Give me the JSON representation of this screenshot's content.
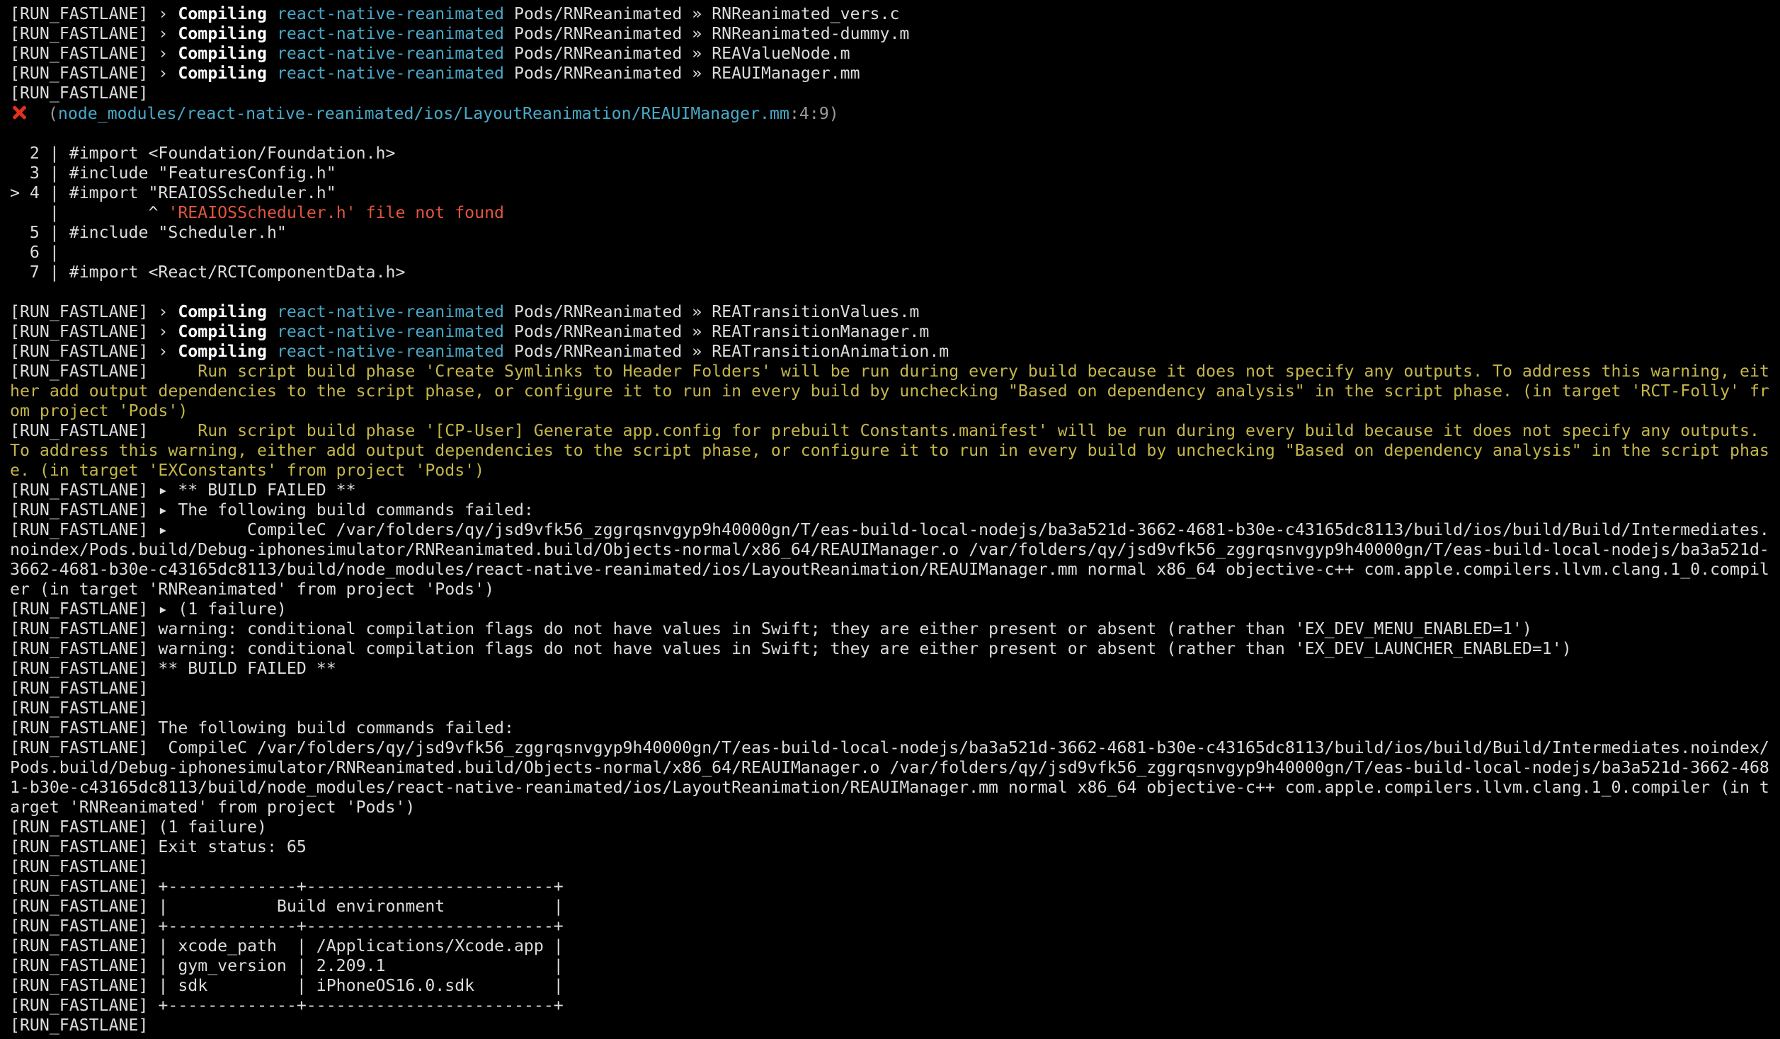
{
  "colors": {
    "background": "#000000",
    "text": "#dcdcdc",
    "bold": "#ffffff",
    "module": "#48a9c8",
    "error": "#e0553f",
    "warning": "#c4b64a",
    "error_icon": "#e0311f"
  },
  "icons": {
    "error": "cross-mark-icon"
  },
  "lines": [
    {
      "segs": [
        {
          "t": "[RUN_FASTLANE] › "
        },
        {
          "t": "Compiling",
          "c": "bold"
        },
        {
          "t": " "
        },
        {
          "t": "react-native-reanimated",
          "c": "cyan"
        },
        {
          "t": " Pods/RNReanimated » RNReanimated_vers.c"
        }
      ]
    },
    {
      "segs": [
        {
          "t": "[RUN_FASTLANE] › "
        },
        {
          "t": "Compiling",
          "c": "bold"
        },
        {
          "t": " "
        },
        {
          "t": "react-native-reanimated",
          "c": "cyan"
        },
        {
          "t": " Pods/RNReanimated » RNReanimated-dummy.m"
        }
      ]
    },
    {
      "segs": [
        {
          "t": "[RUN_FASTLANE] › "
        },
        {
          "t": "Compiling",
          "c": "bold"
        },
        {
          "t": " "
        },
        {
          "t": "react-native-reanimated",
          "c": "cyan"
        },
        {
          "t": " Pods/RNReanimated » REAValueNode.m"
        }
      ]
    },
    {
      "segs": [
        {
          "t": "[RUN_FASTLANE] › "
        },
        {
          "t": "Compiling",
          "c": "bold"
        },
        {
          "t": " "
        },
        {
          "t": "react-native-reanimated",
          "c": "cyan"
        },
        {
          "t": " Pods/RNReanimated » REAUIManager.mm"
        }
      ]
    },
    {
      "segs": [
        {
          "t": "[RUN_FASTLANE]"
        }
      ]
    },
    {
      "icon": true,
      "segs": [
        {
          "t": "  (",
          "c": "dim"
        },
        {
          "t": "node_modules/react-native-reanimated/ios/LayoutReanimation/REAUIManager.mm",
          "c": "cyan"
        },
        {
          "t": ":4:9)",
          "c": "dim"
        }
      ]
    },
    {
      "segs": [
        {
          "t": ""
        }
      ]
    },
    {
      "segs": [
        {
          "t": "  2 | #import <Foundation/Foundation.h>"
        }
      ]
    },
    {
      "segs": [
        {
          "t": "  3 | #include \"FeaturesConfig.h\""
        }
      ]
    },
    {
      "segs": [
        {
          "t": "> 4 | #import \"REAIOSScheduler.h\""
        }
      ]
    },
    {
      "segs": [
        {
          "t": "    |         ^ "
        },
        {
          "t": "'REAIOSScheduler.h' file not found",
          "c": "red"
        }
      ]
    },
    {
      "segs": [
        {
          "t": "  5 | #include \"Scheduler.h\""
        }
      ]
    },
    {
      "segs": [
        {
          "t": "  6 |"
        }
      ]
    },
    {
      "segs": [
        {
          "t": "  7 | #import <React/RCTComponentData.h>"
        }
      ]
    },
    {
      "segs": [
        {
          "t": ""
        }
      ]
    },
    {
      "segs": [
        {
          "t": "[RUN_FASTLANE] › "
        },
        {
          "t": "Compiling",
          "c": "bold"
        },
        {
          "t": " "
        },
        {
          "t": "react-native-reanimated",
          "c": "cyan"
        },
        {
          "t": " Pods/RNReanimated » REATransitionValues.m"
        }
      ]
    },
    {
      "segs": [
        {
          "t": "[RUN_FASTLANE] › "
        },
        {
          "t": "Compiling",
          "c": "bold"
        },
        {
          "t": " "
        },
        {
          "t": "react-native-reanimated",
          "c": "cyan"
        },
        {
          "t": " Pods/RNReanimated » REATransitionManager.m"
        }
      ]
    },
    {
      "segs": [
        {
          "t": "[RUN_FASTLANE] › "
        },
        {
          "t": "Compiling",
          "c": "bold"
        },
        {
          "t": " "
        },
        {
          "t": "react-native-reanimated",
          "c": "cyan"
        },
        {
          "t": " Pods/RNReanimated » REATransitionAnimation.m"
        }
      ]
    },
    {
      "wrap": true,
      "segs": [
        {
          "t": "[RUN_FASTLANE]     "
        },
        {
          "t": "Run script build phase 'Create Symlinks to Header Folders' will be run during every build because it does not specify any outputs. To address this warning, either add output dependencies to the script phase, or configure it to run in every build by unchecking \"Based on dependency analysis\" in the script phase. (in target 'RCT-Folly' from project 'Pods')",
          "c": "yellow"
        }
      ]
    },
    {
      "wrap": true,
      "segs": [
        {
          "t": "[RUN_FASTLANE]     "
        },
        {
          "t": "Run script build phase '[CP-User] Generate app.config for prebuilt Constants.manifest' will be run during every build because it does not specify any outputs. To address this warning, either add output dependencies to the script phase, or configure it to run in every build by unchecking \"Based on dependency analysis\" in the script phase. (in target 'EXConstants' from project 'Pods')",
          "c": "yellow"
        }
      ]
    },
    {
      "segs": [
        {
          "t": "[RUN_FASTLANE] ▸ ** BUILD FAILED **"
        }
      ]
    },
    {
      "segs": [
        {
          "t": "[RUN_FASTLANE] ▸ The following build commands failed:"
        }
      ]
    },
    {
      "wrap": true,
      "segs": [
        {
          "t": "[RUN_FASTLANE] ▸ \tCompileC /var/folders/qy/jsd9vfk56_zggrqsnvgyp9h40000gn/T/eas-build-local-nodejs/ba3a521d-3662-4681-b30e-c43165dc8113/build/ios/build/Build/Intermediates.noindex/Pods.build/Debug-iphonesimulator/RNReanimated.build/Objects-normal/x86_64/REAUIManager.o /var/folders/qy/jsd9vfk56_zggrqsnvgyp9h40000gn/T/eas-build-local-nodejs/ba3a521d-3662-4681-b30e-c43165dc8113/build/node_modules/react-native-reanimated/ios/LayoutReanimation/REAUIManager.mm normal x86_64 objective-c++ com.apple.compilers.llvm.clang.1_0.compiler (in target 'RNReanimated' from project 'Pods')"
        }
      ]
    },
    {
      "segs": [
        {
          "t": "[RUN_FASTLANE] ▸ (1 failure)"
        }
      ]
    },
    {
      "segs": [
        {
          "t": "[RUN_FASTLANE] warning: conditional compilation flags do not have values in Swift; they are either present or absent (rather than 'EX_DEV_MENU_ENABLED=1')"
        }
      ]
    },
    {
      "segs": [
        {
          "t": "[RUN_FASTLANE] warning: conditional compilation flags do not have values in Swift; they are either present or absent (rather than 'EX_DEV_LAUNCHER_ENABLED=1')"
        }
      ]
    },
    {
      "segs": [
        {
          "t": "[RUN_FASTLANE] ** BUILD FAILED **"
        }
      ]
    },
    {
      "segs": [
        {
          "t": "[RUN_FASTLANE]"
        }
      ]
    },
    {
      "segs": [
        {
          "t": "[RUN_FASTLANE]"
        }
      ]
    },
    {
      "segs": [
        {
          "t": "[RUN_FASTLANE] The following build commands failed:"
        }
      ]
    },
    {
      "wrap": true,
      "segs": [
        {
          "t": "[RUN_FASTLANE]  CompileC /var/folders/qy/jsd9vfk56_zggrqsnvgyp9h40000gn/T/eas-build-local-nodejs/ba3a521d-3662-4681-b30e-c43165dc8113/build/ios/build/Build/Intermediates.noindex/Pods.build/Debug-iphonesimulator/RNReanimated.build/Objects-normal/x86_64/REAUIManager.o /var/folders/qy/jsd9vfk56_zggrqsnvgyp9h40000gn/T/eas-build-local-nodejs/ba3a521d-3662-4681-b30e-c43165dc8113/build/node_modules/react-native-reanimated/ios/LayoutReanimation/REAUIManager.mm normal x86_64 objective-c++ com.apple.compilers.llvm.clang.1_0.compiler (in target 'RNReanimated' from project 'Pods')"
        }
      ]
    },
    {
      "segs": [
        {
          "t": "[RUN_FASTLANE] (1 failure)"
        }
      ]
    },
    {
      "segs": [
        {
          "t": "[RUN_FASTLANE] Exit status: 65"
        }
      ]
    },
    {
      "segs": [
        {
          "t": "[RUN_FASTLANE]"
        }
      ]
    },
    {
      "segs": [
        {
          "t": "[RUN_FASTLANE] +-------------+-------------------------+"
        }
      ]
    },
    {
      "segs": [
        {
          "t": "[RUN_FASTLANE] |           Build environment           |"
        }
      ]
    },
    {
      "segs": [
        {
          "t": "[RUN_FASTLANE] +-------------+-------------------------+"
        }
      ]
    },
    {
      "segs": [
        {
          "t": "[RUN_FASTLANE] | xcode_path  | /Applications/Xcode.app |"
        }
      ]
    },
    {
      "segs": [
        {
          "t": "[RUN_FASTLANE] | gym_version | 2.209.1                 |"
        }
      ]
    },
    {
      "segs": [
        {
          "t": "[RUN_FASTLANE] | sdk         | iPhoneOS16.0.sdk        |"
        }
      ]
    },
    {
      "segs": [
        {
          "t": "[RUN_FASTLANE] +-------------+-------------------------+"
        }
      ]
    },
    {
      "segs": [
        {
          "t": "[RUN_FASTLANE]"
        }
      ]
    }
  ]
}
